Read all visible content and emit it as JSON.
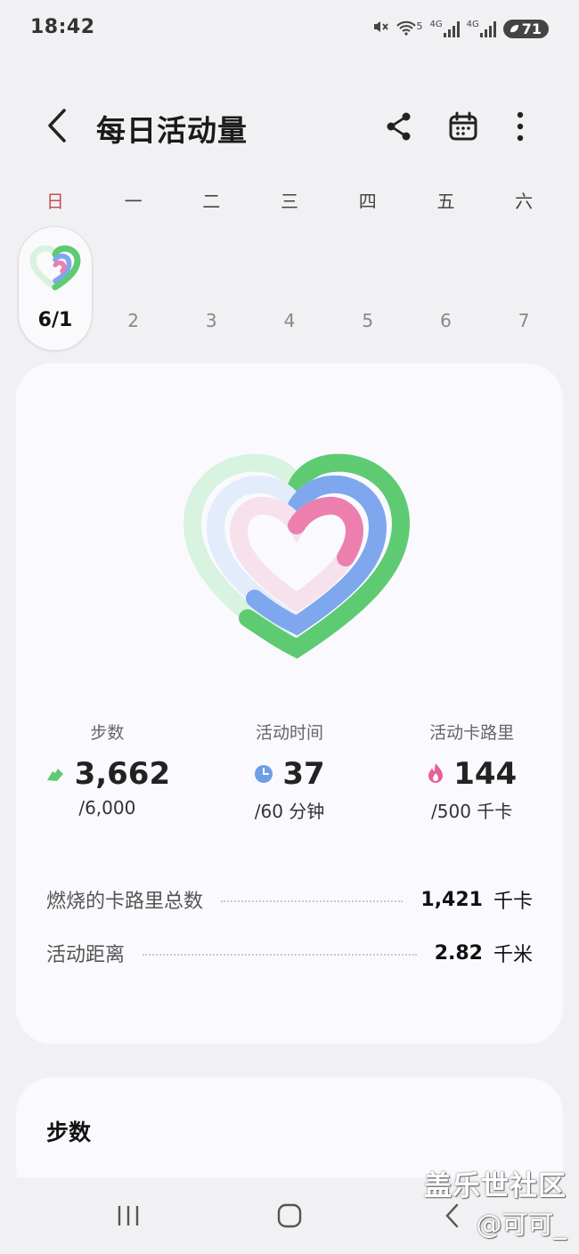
{
  "status": {
    "time": "18:42",
    "net1": "5",
    "net2": "4G",
    "net3": "4G",
    "battery": "71"
  },
  "header": {
    "title": "每日活动量"
  },
  "week": {
    "days": [
      "日",
      "一",
      "二",
      "三",
      "四",
      "五",
      "六"
    ],
    "dates": [
      "6/1",
      "2",
      "3",
      "4",
      "5",
      "6",
      "7"
    ]
  },
  "summary": {
    "steps": {
      "label": "步数",
      "value": "3,662",
      "goal": "/6,000",
      "progress": 0.61
    },
    "time": {
      "label": "活动时间",
      "value": "37",
      "goal": "/60 分钟",
      "progress": 0.62
    },
    "calories": {
      "label": "活动卡路里",
      "value": "144",
      "goal": "/500 千卡",
      "progress": 0.29
    },
    "colors": {
      "steps": "#5ecb73",
      "time": "#7ea7ee",
      "calories": "#ec7fae"
    }
  },
  "details": [
    {
      "label": "燃烧的卡路里总数",
      "value": "1,421",
      "unit": "千卡"
    },
    {
      "label": "活动距离",
      "value": "2.82",
      "unit": "千米"
    }
  ],
  "steps_card": {
    "title": "步数"
  },
  "watermark": {
    "line1": "盖乐世社区",
    "line2": "@可可_"
  }
}
